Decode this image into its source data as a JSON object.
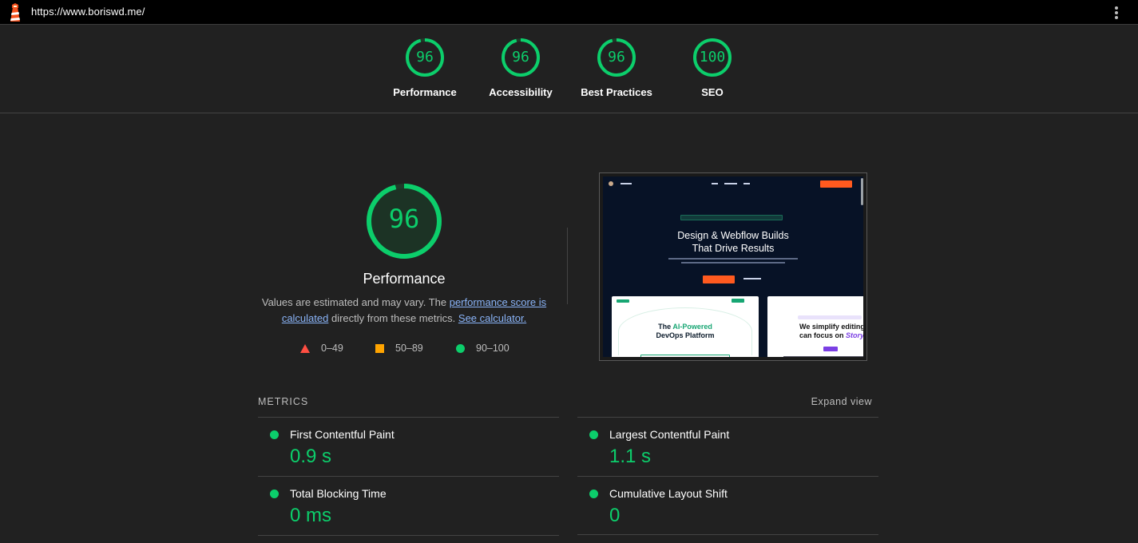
{
  "topbar": {
    "url": "https://www.boriswd.me/",
    "logo_icon": "lighthouse-icon",
    "menu_icon": "kebab-menu-icon"
  },
  "gauges": [
    {
      "score": "96",
      "label": "Performance",
      "fraction": 0.96
    },
    {
      "score": "96",
      "label": "Accessibility",
      "fraction": 0.96
    },
    {
      "score": "96",
      "label": "Best Practices",
      "fraction": 0.96
    },
    {
      "score": "100",
      "label": "SEO",
      "fraction": 1.0
    }
  ],
  "performance": {
    "score": "96",
    "fraction": 0.96,
    "title": "Performance",
    "desc_before": "Values are estimated and may vary. The ",
    "link1_text": "performance score is calculated",
    "desc_middle": " directly from these metrics. ",
    "link2_text": "See calculator."
  },
  "legend": [
    {
      "icon": "triangle-icon",
      "range": "0–49"
    },
    {
      "icon": "square-icon",
      "range": "50–89"
    },
    {
      "icon": "circle-icon",
      "range": "90–100"
    }
  ],
  "screenshot": {
    "headline_line1": "Design & Webflow Builds",
    "headline_line2": "That Drive Results",
    "card1_prefix": "The ",
    "card1_accent": "AI-Powered",
    "card1_line2": "DevOps Platform",
    "card2_line1": "We simplify editing",
    "card2_prefix": "can focus on ",
    "card2_accent": "Story"
  },
  "metrics": {
    "header": "METRICS",
    "expand_label": "Expand view",
    "items": [
      {
        "name": "First Contentful Paint",
        "value": "0.9 s"
      },
      {
        "name": "Largest Contentful Paint",
        "value": "1.1 s"
      },
      {
        "name": "Total Blocking Time",
        "value": "0 ms"
      },
      {
        "name": "Cumulative Layout Shift",
        "value": "0"
      }
    ]
  },
  "colors": {
    "pass": "#0cce6b",
    "average": "#ffa400",
    "fail": "#ff4e42",
    "link": "#8ab4f8",
    "background": "#212121"
  }
}
